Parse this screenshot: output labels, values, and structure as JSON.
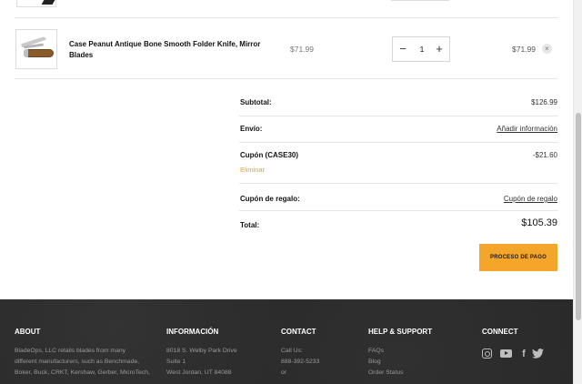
{
  "cart": {
    "item": {
      "title": "Case Peanut Antique Bone Smooth Folder Knife, Mirror Blades",
      "price": "$71.99",
      "quantity": "1",
      "line_total": "$71.99",
      "minus_label": "−",
      "plus_label": "+",
      "remove_label": "×"
    }
  },
  "totals": {
    "subtotal_label": "Subtotal:",
    "subtotal_value": "$126.99",
    "shipping_label": "Envío:",
    "shipping_link": "Añadir información",
    "coupon_label": "Cupón (CASE30)",
    "coupon_value": "-$21.60",
    "coupon_remove": "Eliminar",
    "gift_label": "Cupón de regalo:",
    "gift_link": "Cupón de regalo",
    "total_label": "Total:",
    "total_value": "$105.39",
    "checkout_button": "PROCESO DE PAGO"
  },
  "footer": {
    "about": {
      "heading": "ABOUT",
      "lines": [
        "BladeOps, LLC retails blades from many",
        "different manufacturers, such as Benchmade,",
        "Boker, Buck, CRKT, Kershaw, Gerber, MicroTech,"
      ]
    },
    "info": {
      "heading": "INFORMACIÓN",
      "lines": [
        "8018 S. Welby Park Drive",
        "Suite 1",
        "West Jordan, UT 84088"
      ]
    },
    "contact": {
      "heading": "CONTACT",
      "lines": [
        "Call Us:",
        "888-392-5233",
        "or"
      ]
    },
    "help": {
      "heading": "HELP & SUPPORT",
      "lines": [
        "FAQs",
        "Blog",
        "Order Status"
      ]
    },
    "connect": {
      "heading": "CONNECT",
      "icons": [
        "instagram-icon",
        "youtube-icon",
        "facebook-icon",
        "twitter-icon"
      ],
      "facebook_glyph": "f",
      "twitter_glyph": "🐦"
    }
  },
  "colors": {
    "accent": "#f4a62a",
    "footer_bg": "#2a2a2a"
  }
}
